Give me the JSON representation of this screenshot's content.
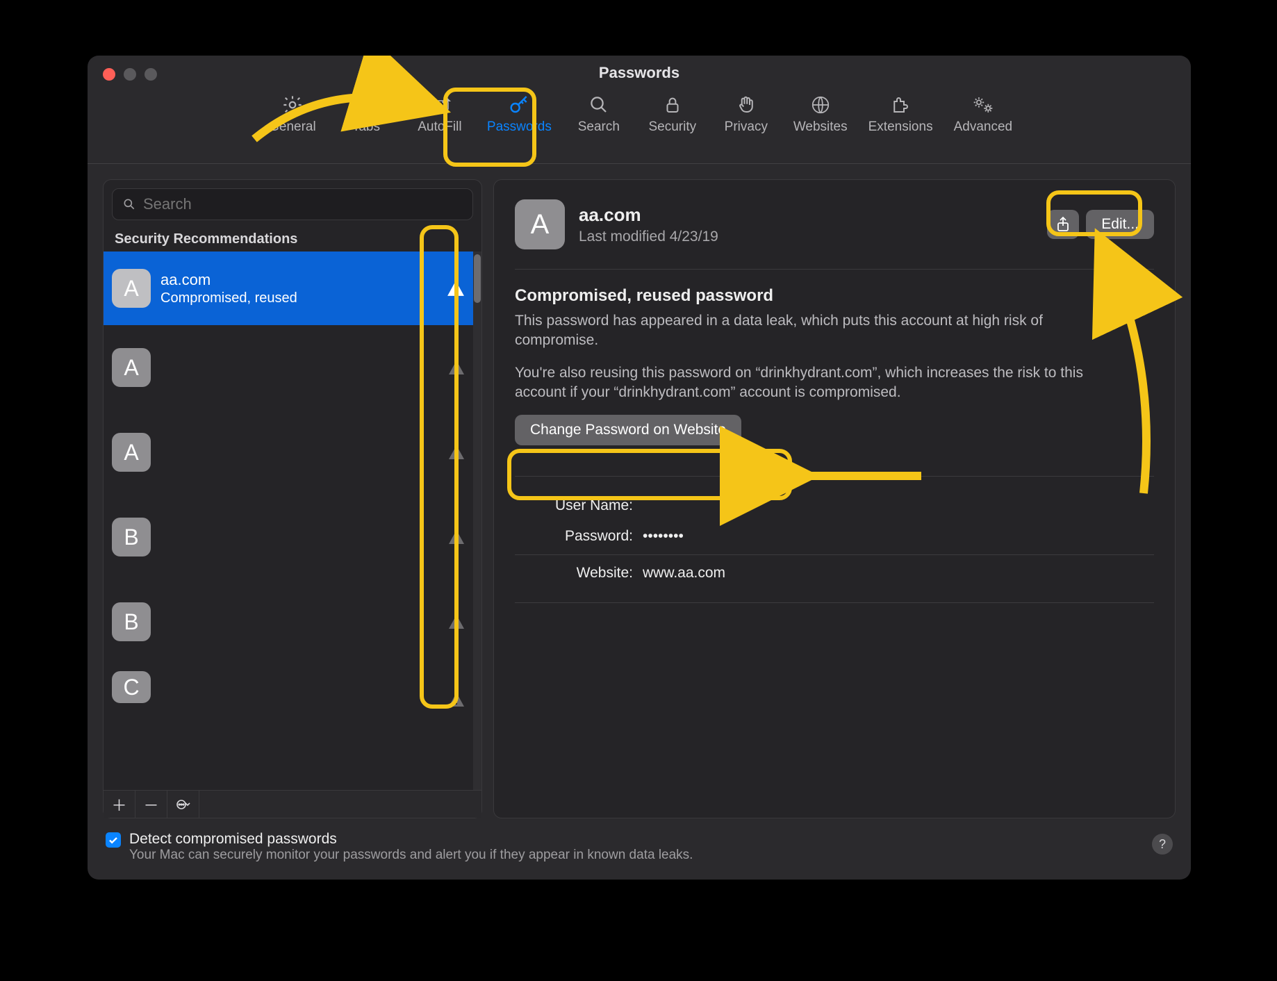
{
  "window": {
    "title": "Passwords"
  },
  "toolbar": {
    "items": [
      {
        "label": "General"
      },
      {
        "label": "Tabs"
      },
      {
        "label": "AutoFill"
      },
      {
        "label": "Passwords",
        "active": true
      },
      {
        "label": "Search"
      },
      {
        "label": "Security"
      },
      {
        "label": "Privacy"
      },
      {
        "label": "Websites"
      },
      {
        "label": "Extensions"
      },
      {
        "label": "Advanced"
      }
    ]
  },
  "sidebar": {
    "search_placeholder": "Search",
    "section_label": "Security Recommendations",
    "items": [
      {
        "letter": "A",
        "site": "aa.com",
        "subtitle": "Compromised, reused",
        "selected": true,
        "warn": true
      },
      {
        "letter": "A",
        "warn": true
      },
      {
        "letter": "A",
        "warn": true
      },
      {
        "letter": "B",
        "warn": true
      },
      {
        "letter": "B",
        "warn": true
      },
      {
        "letter": "C",
        "warn": true
      }
    ]
  },
  "detail": {
    "avatar_letter": "A",
    "site": "aa.com",
    "modified": "Last modified 4/23/19",
    "edit_label": "Edit...",
    "warn_title": "Compromised, reused password",
    "warn_p1": "This password has appeared in a data leak, which puts this account at high risk of compromise.",
    "warn_p2": "You're also reusing this password on “drinkhydrant.com”, which increases the risk to this account if your “drinkhydrant.com” account is compromised.",
    "change_btn": "Change Password on Website",
    "fields": {
      "user_name_label": "User Name:",
      "user_name_value": "",
      "password_label": "Password:",
      "password_value": "••••••••",
      "website_label": "Website:",
      "website_value": "www.aa.com"
    }
  },
  "footer": {
    "checkbox_checked": true,
    "title": "Detect compromised passwords",
    "subtitle": "Your Mac can securely monitor your passwords and alert you if they appear in known data leaks."
  }
}
